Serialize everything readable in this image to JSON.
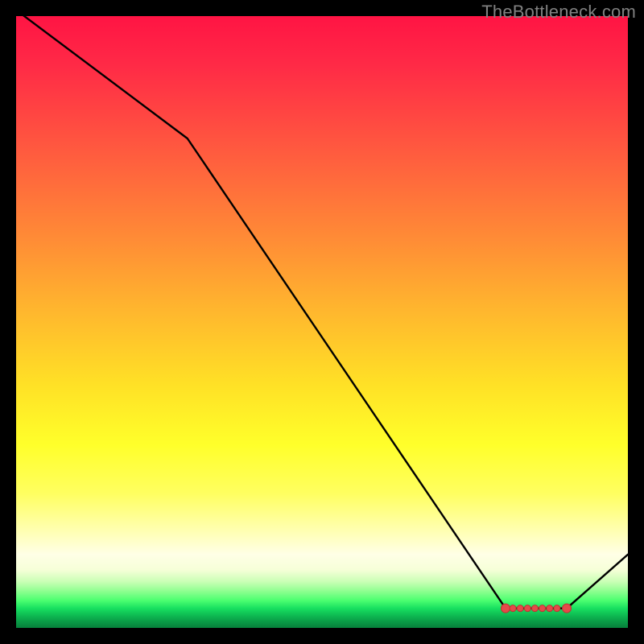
{
  "watermark": "TheBottleneck.com",
  "chart_data": {
    "type": "line",
    "title": "",
    "xlabel": "",
    "ylabel": "",
    "xlim": [
      0,
      100
    ],
    "ylim": [
      0,
      100
    ],
    "series": [
      {
        "name": "bottleneck-curve",
        "x": [
          0,
          28,
          80,
          90,
          100
        ],
        "values": [
          101,
          80,
          3.2,
          3.2,
          12
        ]
      }
    ],
    "optimum_band": {
      "x_start": 80,
      "x_end": 90,
      "y": 3.2
    },
    "marker_cluster_x": [
      80,
      81.2,
      82.4,
      83.6,
      84.8,
      86,
      87.2,
      88.4,
      90
    ]
  }
}
